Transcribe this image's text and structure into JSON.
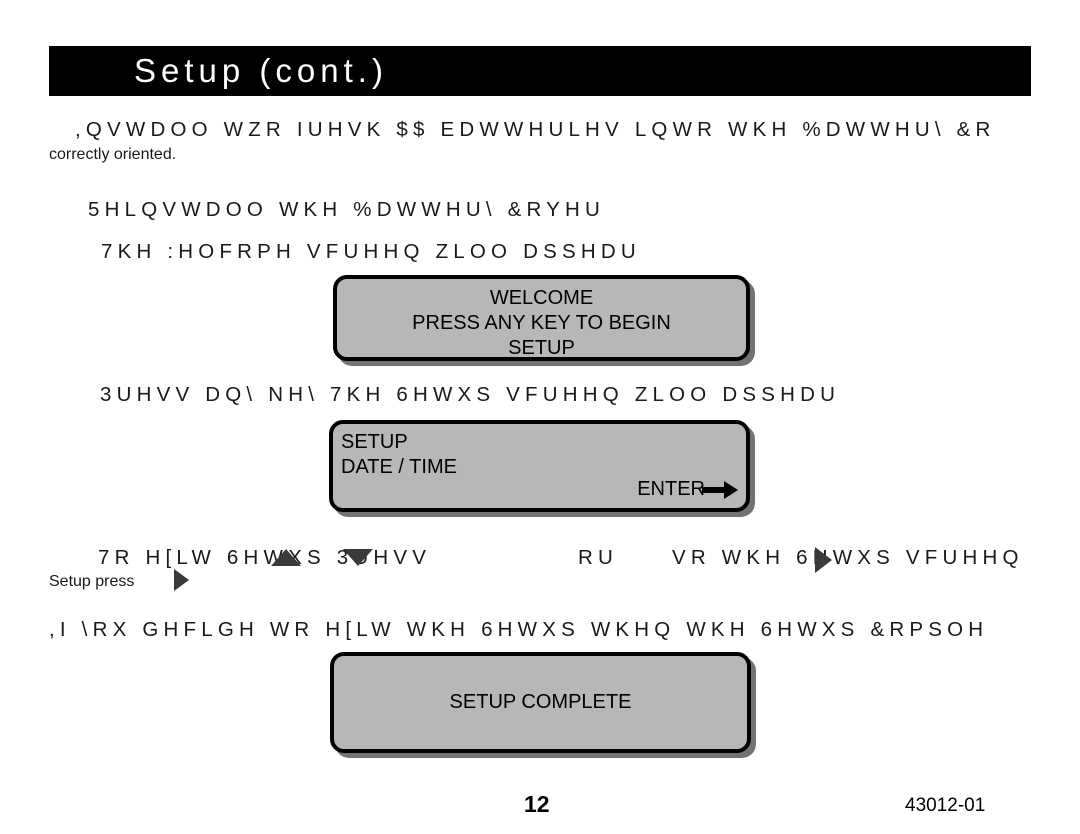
{
  "header": {
    "title": "Setup  (cont.)"
  },
  "body": {
    "intro_line_1": ",QVWDOO WZR IUHVK $$ EDWWHULHV LQWR WKH %DWWHU\\ &R",
    "intro_line_2": "correctly oriented.",
    "reinstall_heading": "5HLQVWDOO WKH %DWWHU\\ &RYHU",
    "welcome_heading": "7KH :HOFRPH VFUHHQ ZLOO DSSHDU",
    "press_any_key_heading": "3UHVV DQ\\ NH\\  7KH 6HWXS VFUHHQ ZLOO DSSHDU",
    "to_exit_part_1": "7R H[LW 6HWXS 3UHVV",
    "to_exit_part_2": "RU",
    "to_exit_part_3": "VR WKH 6HWXS VFUHHQ",
    "setup_press_line": "Setup press",
    "setup_press_period": ".",
    "if_you_decide_line": ",I \\RX GHFLGH WR H[LW WKH 6HWXS  WKHQ WKH 6HWXS &RPSOH"
  },
  "lcd_screens": [
    {
      "id": "welcome",
      "alignment": "center",
      "lines": [
        "WELCOME",
        "PRESS ANY KEY TO BEGIN",
        "SETUP"
      ]
    },
    {
      "id": "setup",
      "alignment": "left",
      "lines": [
        "SETUP",
        "DATE / TIME"
      ],
      "enter_label": "ENTER",
      "enter_icon": "arrow-right-icon"
    },
    {
      "id": "complete",
      "alignment": "center",
      "lines": [
        "SETUP COMPLETE"
      ]
    }
  ],
  "markers": {
    "up_triangle": "triangle-up-icon",
    "down_triangle": "triangle-down-icon",
    "right_triangle": "triangle-right-icon"
  },
  "footer": {
    "page_number": "12",
    "document_code": "43012-01"
  },
  "colors": {
    "header_background": "#000000",
    "header_text": "#ffffff",
    "lcd_fill": "#b7b7b7",
    "lcd_border": "#000000",
    "page_background": "#ffffff",
    "marker_fill": "#3a3a3a"
  }
}
